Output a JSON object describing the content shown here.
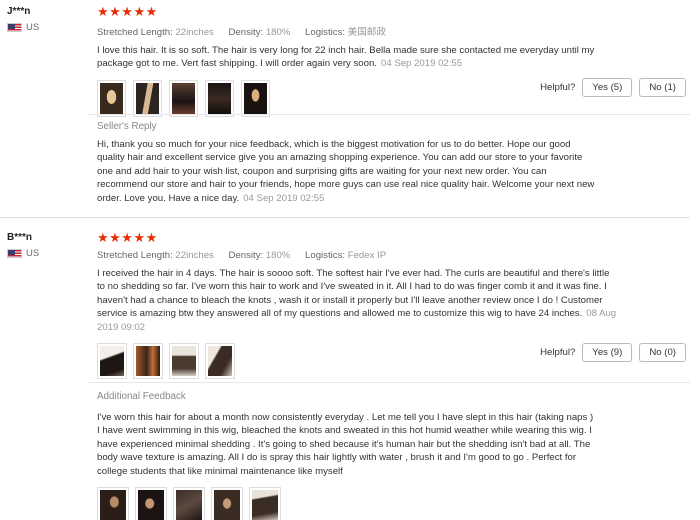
{
  "labels": {
    "stretched_length": "Stretched Length:",
    "density": "Density:",
    "logistics": "Logistics:",
    "helpful": "Helpful?",
    "sellers_reply": "Seller's Reply",
    "additional_feedback": "Additional Feedback"
  },
  "reviews": [
    {
      "user": "J***n",
      "country": "US",
      "stars": "★★★★★",
      "rating": 5,
      "stretched_length": "22inches",
      "density": "180%",
      "logistics": "美国邮政",
      "text": "I love this hair. It is so soft. The hair is very long for 22 inch hair. Bella made sure she contacted me everyday until my package got to me. Vert fast shipping. I will order again very soon.",
      "date": "04 Sep 2019 02:55",
      "yes_label": "Yes (5)",
      "no_label": "No (1)",
      "reply_text": "Hi, thank you so much for your nice feedback, which is the biggest motivation for us to do better. Hope our good quality hair and excellent service give you an amazing shopping experience. You can add our store to your favorite one and add hair to your wish list, coupon and surprising gifts are waiting for your next new order. You can recommend our store and hair to your friends, hope more guys can use real nice quality hair. Welcome your next new order. Love you. Have a nice day.",
      "reply_date": "04 Sep 2019 02:55"
    },
    {
      "user": "B***n",
      "country": "US",
      "stars": "★★★★★",
      "rating": 5,
      "stretched_length": "22inches",
      "density": "180%",
      "logistics": "Fedex IP",
      "text": "I received the hair in 4 days. The hair is soooo soft. The softest hair I've ever had. The curls are beautiful and there's little to no shedding so far. I've worn this hair to work and I've sweated in it. All I had to do was finger comb it and it was fine. I haven't had a chance to bleach the knots , wash it or install it properly but I'll leave another review once I do ! Customer service is amazing btw they answered all of my questions and allowed me to customize this wig to have 24 inches.",
      "date": "08 Aug 2019 09:02",
      "yes_label": "Yes (9)",
      "no_label": "No (0)",
      "additional_text": "I've worn this hair for about a month now consistently everyday . Let me tell you I have slept in this hair (taking naps ) I have went swimming in this wig, bleached the knots and sweated in this hot humid weather while wearing this wig. I have experienced minimal shedding . It's going to shed because it's human hair but the shedding isn't bad at all. The body wave texture is amazing. All I do is spray this hair lightly with water , brush it and I'm good to go . Perfect for college students that like minimal maintenance like myself"
    }
  ]
}
